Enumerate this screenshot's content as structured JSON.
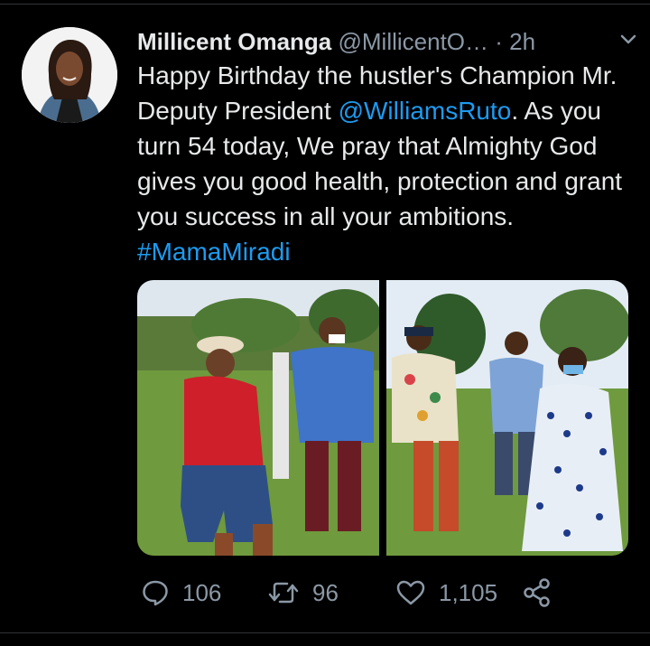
{
  "tweet": {
    "author_name": "Millicent Omanga",
    "author_handle": "@MillicentO…",
    "separator": "·",
    "time": "2h",
    "text_part1": "Happy Birthday the hustler's Champion Mr. Deputy President ",
    "mention": "@WilliamsRuto",
    "text_part2": ". As you turn 54 today, We pray that Almighty God gives you good health, protection and grant you success in all your ambitions. ",
    "hashtag": "#MamaMiradi"
  },
  "media": {
    "photo_left": "event-photo-left",
    "photo_right": "event-photo-right"
  },
  "actions": {
    "reply_count": "106",
    "retweet_count": "96",
    "like_count": "1,105"
  },
  "colors": {
    "background": "#000000",
    "text": "#e7e9ea",
    "secondary": "#8b98a5",
    "link": "#1d9bf0",
    "divider": "#2f3336"
  },
  "icons": [
    "caret-down-icon",
    "reply-icon",
    "retweet-icon",
    "like-icon",
    "share-icon"
  ]
}
